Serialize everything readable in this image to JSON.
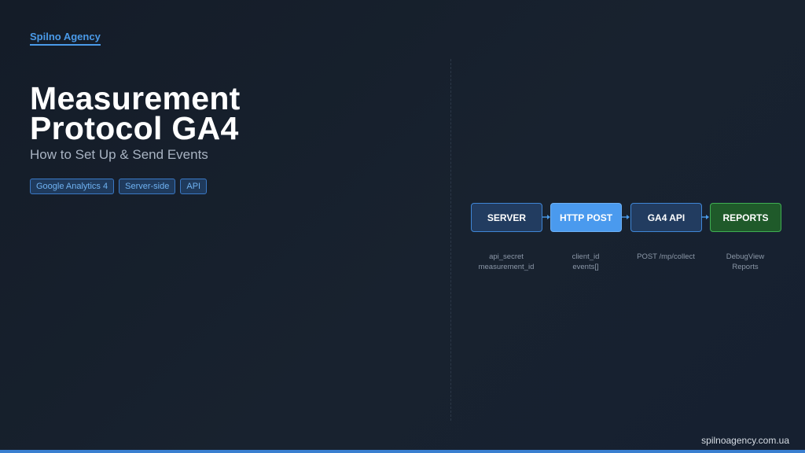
{
  "brand": "Spilno Agency",
  "title": {
    "line1": "Measurement",
    "line2": "Protocol GA4"
  },
  "subtitle": "How to Set Up & Send Events",
  "tags": [
    "Google Analytics 4",
    "Server-side",
    "API"
  ],
  "flow": {
    "nodes": [
      {
        "label": "SERVER",
        "caption": [
          "api_secret",
          "measurement_id"
        ]
      },
      {
        "label": "HTTP POST",
        "caption": [
          "client_id",
          "events[]"
        ]
      },
      {
        "label": "GA4 API",
        "caption": [
          "POST /mp/collect"
        ]
      },
      {
        "label": "REPORTS",
        "caption": [
          "DebugView",
          "Reports"
        ]
      }
    ]
  },
  "footer_url": "spilnoagency.com.ua",
  "colors": {
    "accent": "#4a9ae8",
    "node_dark": "#223c60",
    "node_highlight": "#4a9aee",
    "node_success": "#1f5a2a",
    "background": "#18222f"
  }
}
